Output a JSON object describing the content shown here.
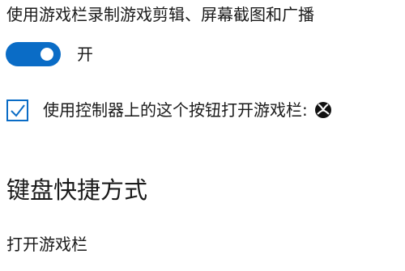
{
  "game_bar_setting": {
    "label": "使用游戏栏录制游戏剪辑、屏幕截图和广播",
    "toggle_state": "开",
    "toggle_on": true,
    "accent_color": "#0a6cc6"
  },
  "controller_option": {
    "checked": true,
    "label": "使用控制器上的这个按钮打开游戏栏:",
    "icon": "xbox-icon"
  },
  "keyboard_shortcuts": {
    "heading": "键盘快捷方式",
    "open_game_bar_label": "打开游戏栏"
  }
}
